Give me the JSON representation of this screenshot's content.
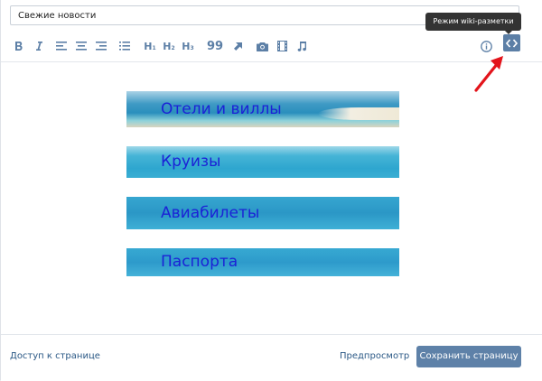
{
  "title_input": {
    "value": "Свежие новости"
  },
  "toolbar": {
    "heading1": "H",
    "heading2": "H",
    "heading3": "H",
    "heading1_sub": "1",
    "heading2_sub": "2",
    "heading3_sub": "3",
    "quote": "99"
  },
  "tooltip": {
    "text": "Режим wiki-разметки"
  },
  "banners": [
    {
      "label": "Отели и виллы"
    },
    {
      "label": "Круизы"
    },
    {
      "label": "Авиабилеты"
    },
    {
      "label": "Паспорта"
    }
  ],
  "footer": {
    "access_label": "Доступ к странице",
    "preview_label": "Предпросмотр",
    "save_label": "Сохранить страницу"
  },
  "colors": {
    "accent": "#5c7fa6",
    "link": "#2a5885",
    "banner_text": "#1b22d6",
    "arrow": "#e3141b"
  }
}
